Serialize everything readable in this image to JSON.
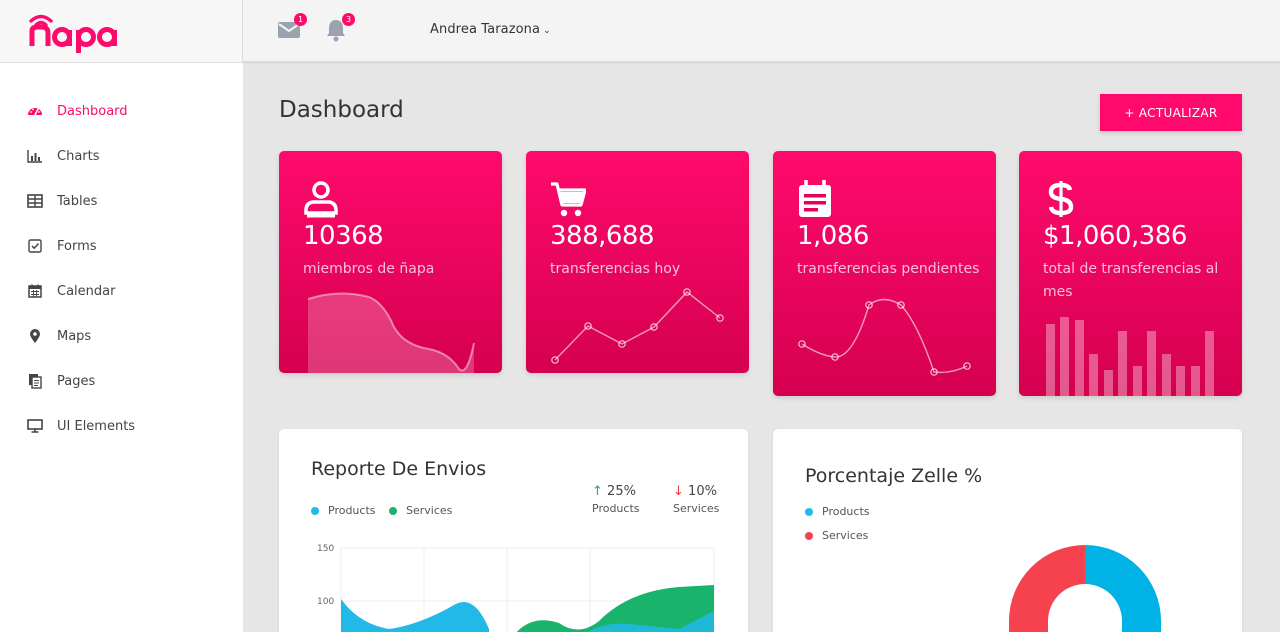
{
  "brand": {
    "name": "ñapa",
    "color": "#ff0a6c"
  },
  "topbar": {
    "mail": {
      "icon": "mail-icon",
      "badge": "1"
    },
    "notifications": {
      "icon": "bell-icon",
      "badge": "3"
    },
    "user_name": "Andrea Tarazona",
    "user_caret": "⌄"
  },
  "sidebar": {
    "items": [
      {
        "label": "Dashboard",
        "icon": "speedometer-icon",
        "active": true
      },
      {
        "label": "Charts",
        "icon": "bar-chart-icon"
      },
      {
        "label": "Tables",
        "icon": "table-icon"
      },
      {
        "label": "Forms",
        "icon": "checkbox-icon"
      },
      {
        "label": "Calendar",
        "icon": "calendar-icon"
      },
      {
        "label": "Maps",
        "icon": "map-pin-icon"
      },
      {
        "label": "Pages",
        "icon": "pages-icon"
      },
      {
        "label": "UI Elements",
        "icon": "monitor-icon"
      }
    ]
  },
  "main": {
    "title": "Dashboard",
    "update_button": "+ ACTUALIZAR",
    "stats": [
      {
        "icon": "user-icon",
        "value": "10368",
        "label": "miembros de ñapa"
      },
      {
        "icon": "cart-icon",
        "value": "388,688",
        "label": "transferencias hoy"
      },
      {
        "icon": "calendar-note-icon",
        "value": "1,086",
        "label": "transferencias pendientes"
      },
      {
        "icon": "dollar-icon",
        "value": "$1,060,386",
        "label": "total de transferencias al mes"
      }
    ]
  },
  "reporte": {
    "title": "Reporte De Envios",
    "legend": [
      {
        "label": "Products",
        "color": "#22b9e8"
      },
      {
        "label": "Services",
        "color": "#19b36b"
      }
    ],
    "trends": [
      {
        "arrow": "↑",
        "pct": "25%",
        "caption": "Products"
      },
      {
        "arrow": "↓",
        "pct": "10%",
        "caption": "Services"
      }
    ],
    "y_ticks": [
      "150",
      "100"
    ]
  },
  "zelle": {
    "title": "Porcentaje Zelle %",
    "legend": [
      {
        "label": "Products",
        "color": "#22b9e8"
      },
      {
        "label": "Services",
        "color": "#f0434f"
      }
    ]
  }
}
